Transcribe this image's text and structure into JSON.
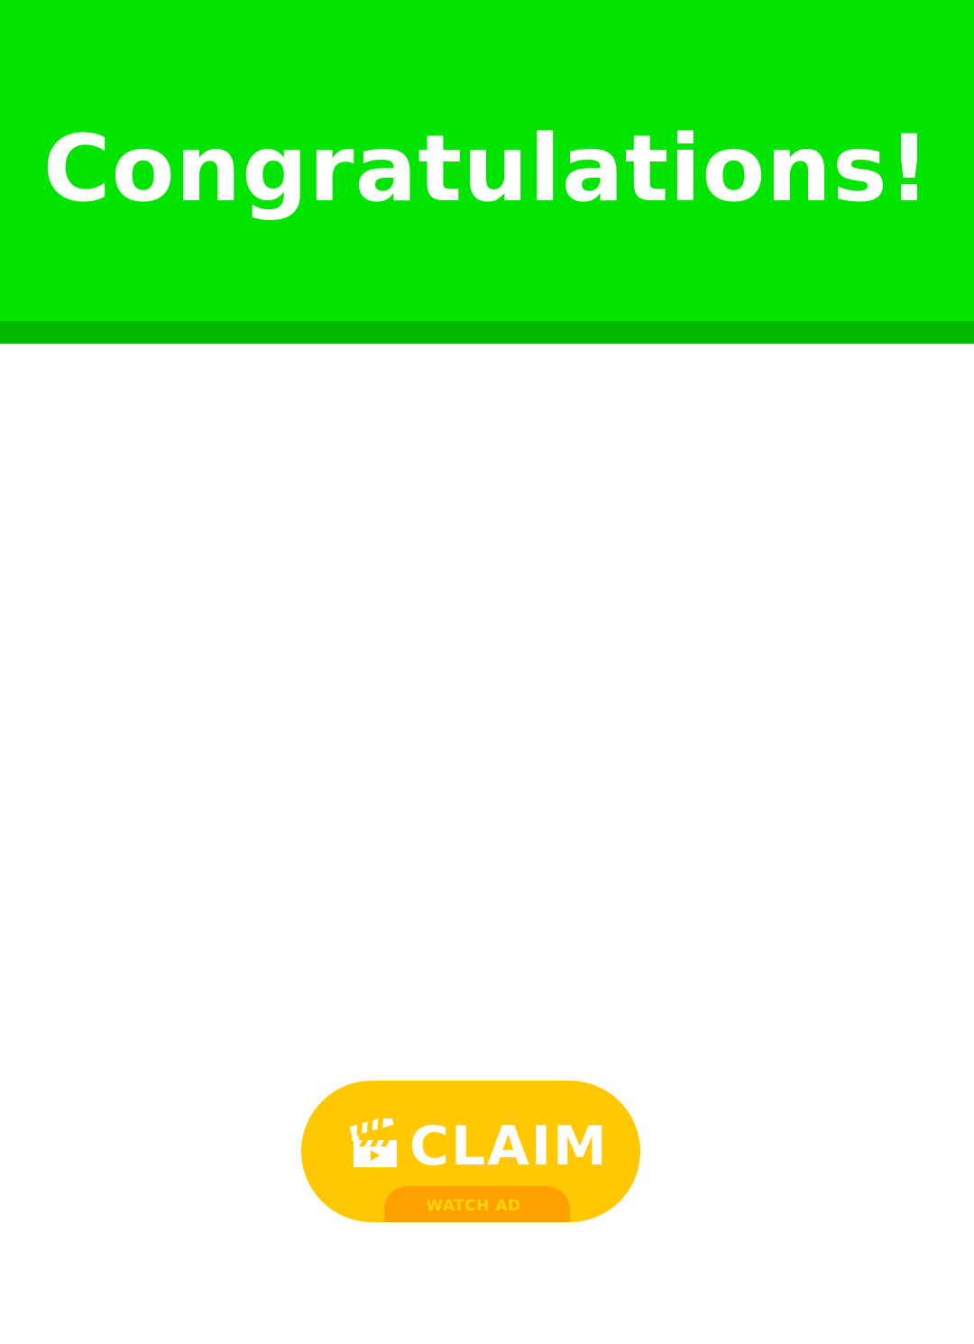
{
  "header": {
    "title": "Congratulations!"
  },
  "claim_button": {
    "label": "CLAIM",
    "icon": "clapperboard-icon",
    "sub_label": "WATCH AD"
  },
  "colors": {
    "header_green": "#00e400",
    "header_shadow_green": "#00b800",
    "button_yellow": "#ffc800",
    "tab_orange": "#ffa000",
    "tab_text_yellow": "#ffd700",
    "text_white": "#ffffff",
    "background": "#ffffff"
  }
}
